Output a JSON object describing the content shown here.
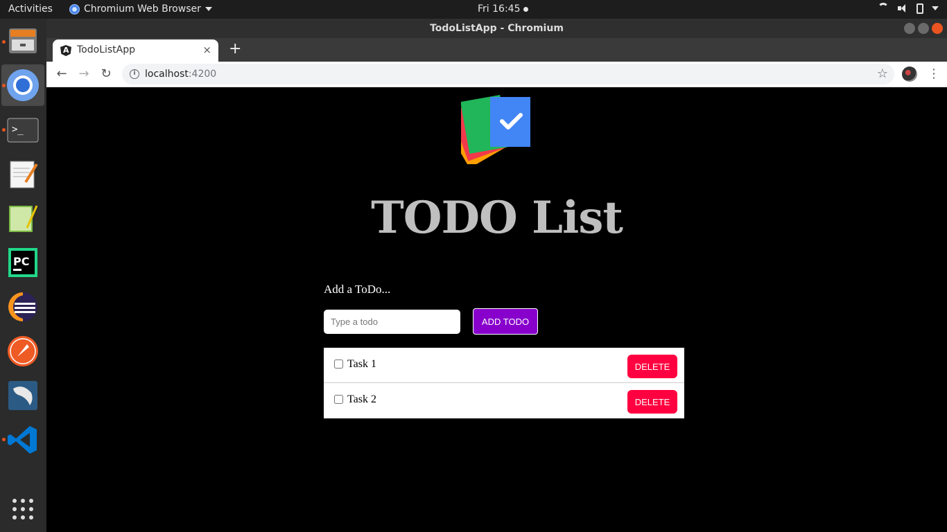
{
  "topbar": {
    "activities": "Activities",
    "app_menu": "Chromium Web Browser",
    "clock": "Fri 16:45"
  },
  "dock": {
    "apps": [
      "file-manager",
      "chromium",
      "terminal",
      "text-editor",
      "notepad",
      "pycharm",
      "eclipse",
      "postman",
      "mysql-workbench",
      "vscode"
    ]
  },
  "window": {
    "title": "TodoListApp - Chromium",
    "tab_title": "TodoListApp",
    "tab_close": "×",
    "new_tab": "+",
    "url_host": "localhost",
    "url_port": ":4200"
  },
  "app": {
    "title": "TODO List",
    "add_label": "Add a ToDo...",
    "input_placeholder": "Type a todo",
    "input_value": "",
    "add_button": "ADD TODO",
    "todos": [
      {
        "text": "Task 1",
        "done": false,
        "delete_label": "DELETE"
      },
      {
        "text": "Task 2",
        "done": false,
        "delete_label": "DELETE"
      }
    ]
  },
  "colors": {
    "add_button_bg": "#8800cc",
    "delete_button_bg": "#ff0040",
    "title_color": "#bfbfbf"
  }
}
